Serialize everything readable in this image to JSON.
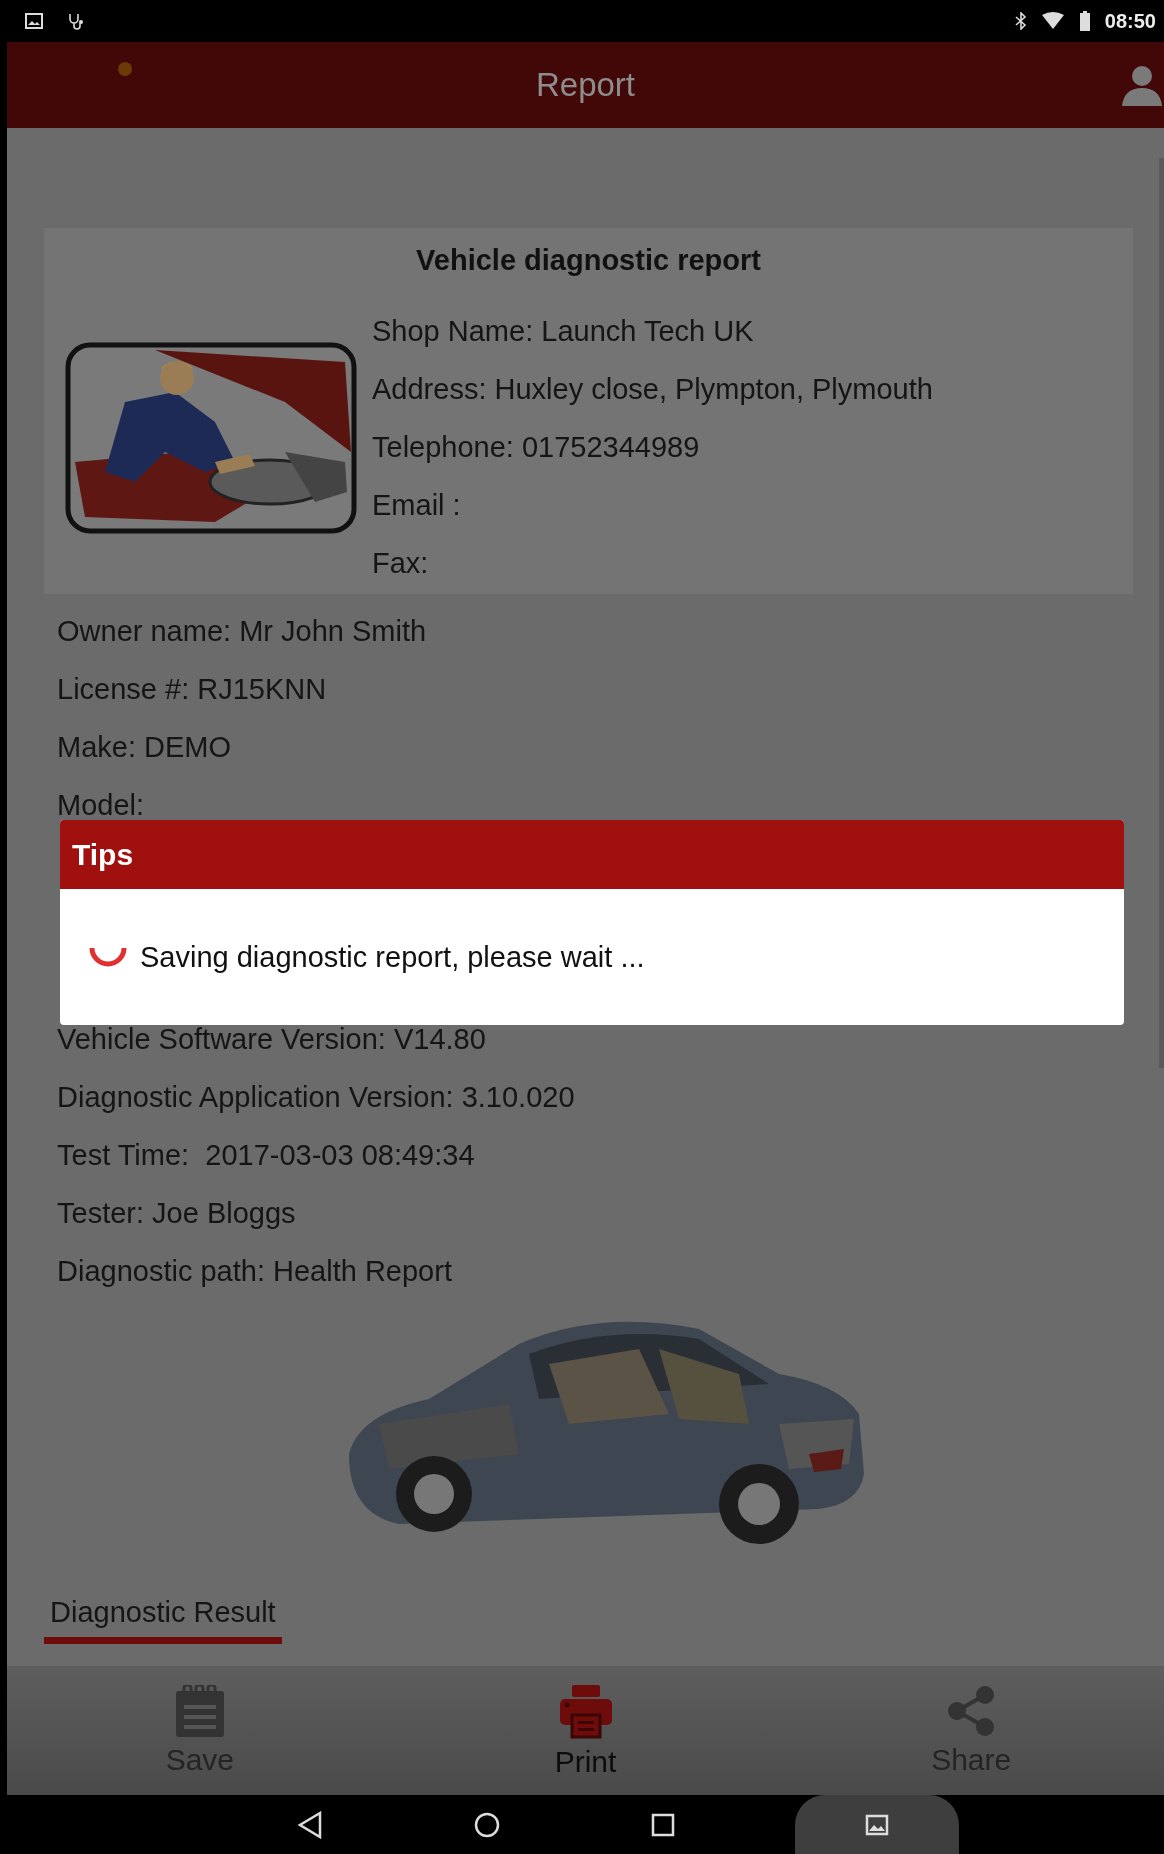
{
  "status_bar": {
    "time": "08:50"
  },
  "app_bar": {
    "title": "Report"
  },
  "report": {
    "title": "Vehicle diagnostic report",
    "shop_lines": [
      "Shop Name: Launch Tech UK",
      "Address: Huxley close, Plympton, Plymouth",
      "Telephone: 01752344989",
      "Email :",
      "Fax:"
    ],
    "details_before": [
      "Owner name: Mr John Smith",
      "License #: RJ15KNN",
      "Make: DEMO",
      "Model:"
    ],
    "details_after": [
      "Vehicle Software Version: V14.80",
      "Diagnostic Application Version: 3.10.020",
      "Test Time:  2017-03-03 08:49:34",
      "Tester: Joe Bloggs",
      "Diagnostic path: Health Report"
    ]
  },
  "section_tab": {
    "label": "Diagnostic Result",
    "selected": true
  },
  "dialog": {
    "title": "Tips",
    "message": "Saving diagnostic report, please wait ..."
  },
  "toolbar": [
    {
      "kind": "save",
      "label": "Save",
      "selected": false
    },
    {
      "kind": "print",
      "label": "Print",
      "selected": true
    },
    {
      "kind": "share",
      "label": "Share",
      "selected": false
    }
  ]
}
